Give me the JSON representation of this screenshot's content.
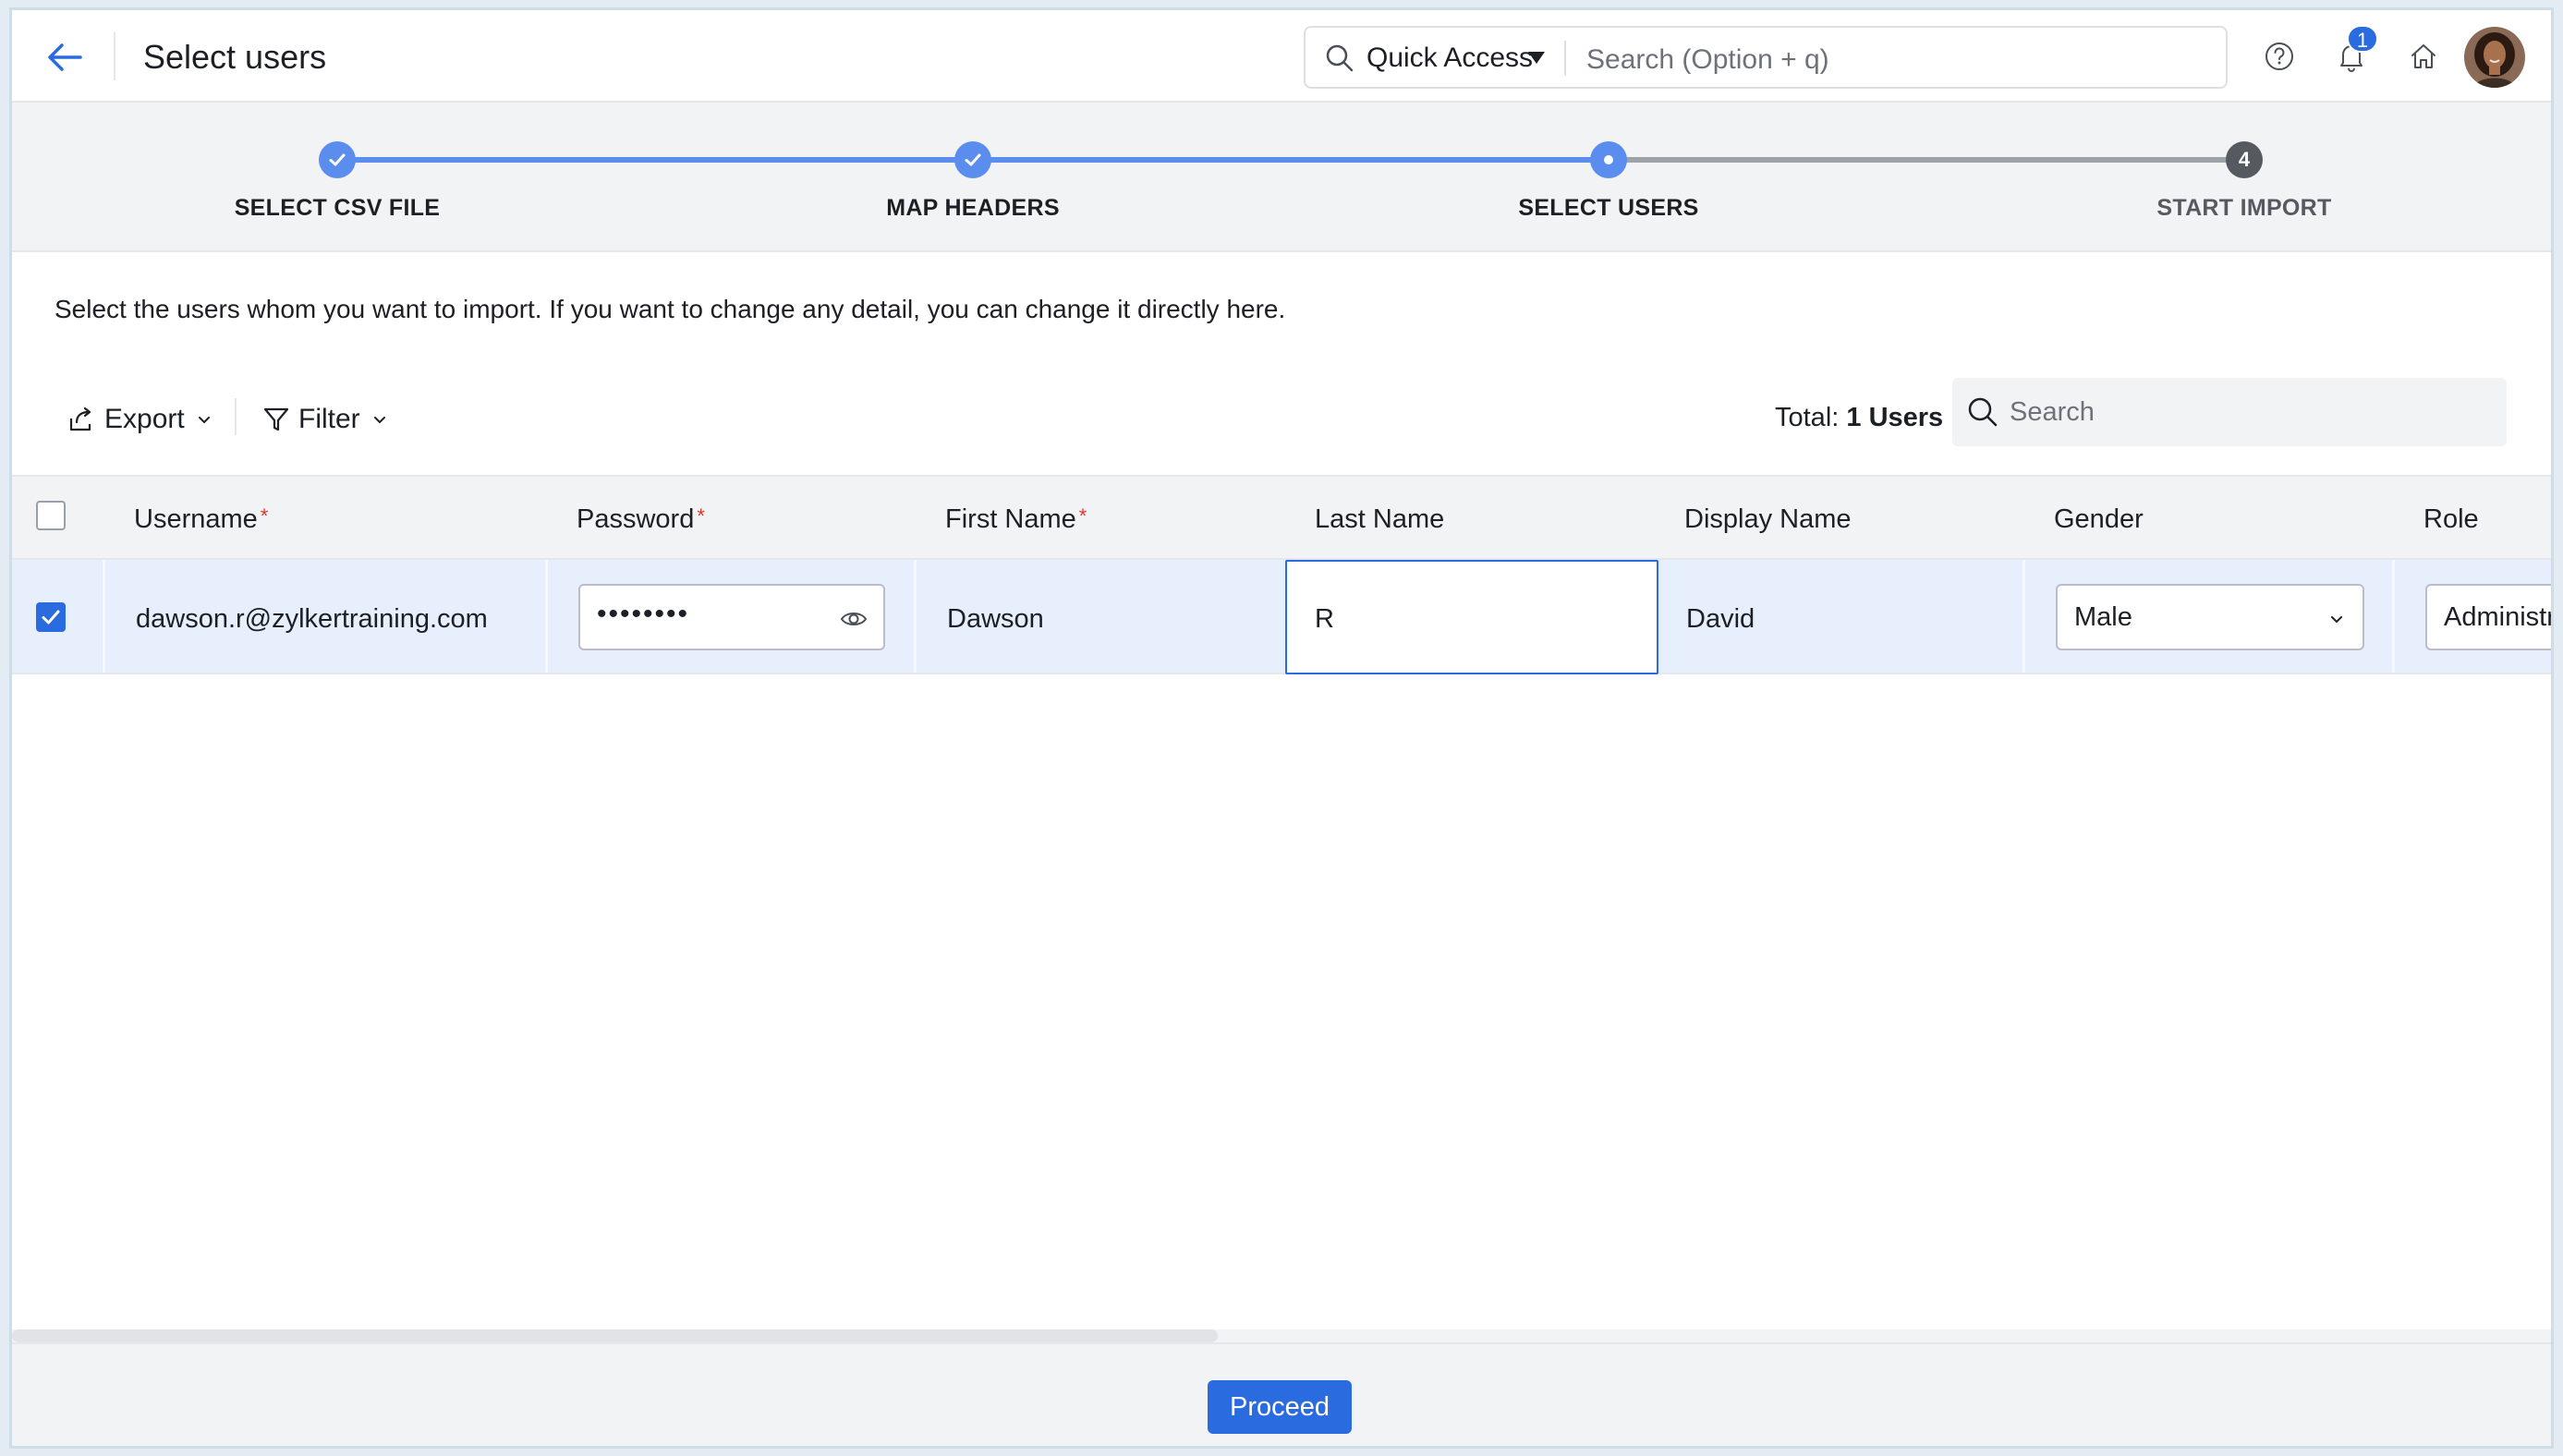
{
  "header": {
    "title": "Select users",
    "quick_access_label": "Quick Access",
    "search_placeholder": "Search (Option + q)",
    "notification_count": "1"
  },
  "stepper": {
    "steps": [
      {
        "label": "SELECT CSV FILE",
        "status": "completed"
      },
      {
        "label": "MAP HEADERS",
        "status": "completed"
      },
      {
        "label": "SELECT USERS",
        "status": "current"
      },
      {
        "label": "START IMPORT",
        "status": "pending",
        "number": "4"
      }
    ]
  },
  "description": "Select the users whom you want to import. If you want to change any detail, you can change it directly here.",
  "toolbar": {
    "export_label": "Export",
    "filter_label": "Filter",
    "total_prefix": "Total:",
    "total_value": "1 Users",
    "search_placeholder": "Search"
  },
  "table": {
    "columns": [
      {
        "label": "Username",
        "required": true
      },
      {
        "label": "Password",
        "required": true
      },
      {
        "label": "First Name",
        "required": true
      },
      {
        "label": "Last Name",
        "required": false
      },
      {
        "label": "Display Name",
        "required": false
      },
      {
        "label": "Gender",
        "required": false
      },
      {
        "label": "Role",
        "required": false
      }
    ],
    "rows": [
      {
        "selected": true,
        "username": "dawson.r@zylkertraining.com",
        "password_mask": "••••••••",
        "first_name": "Dawson",
        "last_name": "R",
        "display_name": "David",
        "gender": "Male",
        "role": "Administrator"
      }
    ]
  },
  "footer": {
    "proceed_label": "Proceed"
  },
  "colors": {
    "accent": "#2a6be0",
    "step_complete": "#5b8def",
    "step_pending": "#555a61",
    "row_selected_bg": "#e8effc",
    "required_star": "#e0352b"
  }
}
